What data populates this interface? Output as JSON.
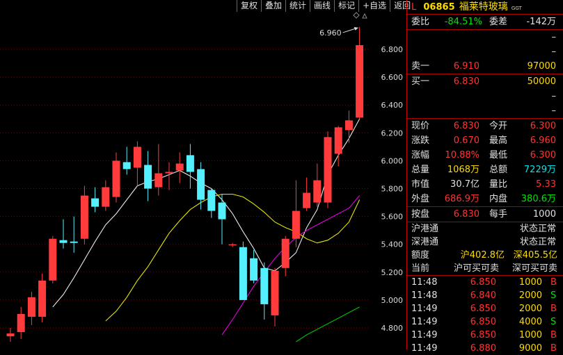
{
  "toolbar": [
    "复权",
    "叠加",
    "统计",
    "画线",
    "标记",
    "+自选",
    "返回"
  ],
  "chart_data": {
    "type": "candlestick",
    "y_ticks": [
      "6.800",
      "6.600",
      "6.400",
      "6.200",
      "6.000",
      "5.800",
      "5.600",
      "5.400",
      "5.200",
      "5.000",
      "4.800"
    ],
    "ylim": [
      4.72,
      7.02
    ],
    "high_annotation": "6.960",
    "candles": [
      {
        "o": 4.74,
        "h": 4.8,
        "l": 4.7,
        "c": 4.76
      },
      {
        "o": 4.77,
        "h": 4.95,
        "l": 4.72,
        "c": 4.9
      },
      {
        "o": 4.88,
        "h": 5.06,
        "l": 4.82,
        "c": 5.02
      },
      {
        "o": 4.88,
        "h": 5.19,
        "l": 4.84,
        "c": 5.14
      },
      {
        "o": 5.14,
        "h": 5.46,
        "l": 5.12,
        "c": 5.44
      },
      {
        "o": 5.43,
        "h": 5.58,
        "l": 5.37,
        "c": 5.41
      },
      {
        "o": 5.42,
        "h": 5.6,
        "l": 5.34,
        "c": 5.41
      },
      {
        "o": 5.44,
        "h": 5.82,
        "l": 5.4,
        "c": 5.75
      },
      {
        "o": 5.73,
        "h": 5.81,
        "l": 5.63,
        "c": 5.67
      },
      {
        "o": 5.67,
        "h": 5.86,
        "l": 5.64,
        "c": 5.81
      },
      {
        "o": 5.74,
        "h": 6.06,
        "l": 5.7,
        "c": 6.0
      },
      {
        "o": 5.99,
        "h": 6.1,
        "l": 5.9,
        "c": 5.94
      },
      {
        "o": 5.95,
        "h": 6.14,
        "l": 5.82,
        "c": 6.1
      },
      {
        "o": 5.97,
        "h": 6.07,
        "l": 5.71,
        "c": 5.8
      },
      {
        "o": 5.81,
        "h": 6.12,
        "l": 5.75,
        "c": 5.91
      },
      {
        "o": 5.91,
        "h": 5.99,
        "l": 5.79,
        "c": 5.92
      },
      {
        "o": 5.93,
        "h": 6.06,
        "l": 5.84,
        "c": 5.98
      },
      {
        "o": 6.04,
        "h": 6.12,
        "l": 5.8,
        "c": 5.92
      },
      {
        "o": 5.94,
        "h": 5.99,
        "l": 5.65,
        "c": 5.72
      },
      {
        "o": 5.79,
        "h": 5.8,
        "l": 5.59,
        "c": 5.64
      },
      {
        "o": 5.7,
        "h": 5.76,
        "l": 5.4,
        "c": 5.58
      },
      {
        "o": 5.4,
        "h": 5.41,
        "l": 5.38,
        "c": 5.4
      },
      {
        "o": 5.38,
        "h": 5.42,
        "l": 5.0,
        "c": 5.0
      },
      {
        "o": 5.3,
        "h": 5.36,
        "l": 5.12,
        "c": 5.14
      },
      {
        "o": 5.23,
        "h": 5.27,
        "l": 4.86,
        "c": 4.97
      },
      {
        "o": 4.89,
        "h": 5.23,
        "l": 4.81,
        "c": 5.21
      },
      {
        "o": 5.23,
        "h": 5.46,
        "l": 5.17,
        "c": 5.44
      },
      {
        "o": 5.44,
        "h": 5.86,
        "l": 5.38,
        "c": 5.64
      },
      {
        "o": 5.66,
        "h": 5.88,
        "l": 5.64,
        "c": 5.77
      },
      {
        "o": 5.7,
        "h": 5.98,
        "l": 5.67,
        "c": 5.86
      },
      {
        "o": 5.7,
        "h": 6.21,
        "l": 5.66,
        "c": 6.17
      },
      {
        "o": 6.05,
        "h": 6.25,
        "l": 5.96,
        "c": 6.24
      },
      {
        "o": 6.22,
        "h": 6.36,
        "l": 6.13,
        "c": 6.29
      },
      {
        "o": 6.31,
        "h": 6.96,
        "l": 6.3,
        "c": 6.83
      }
    ],
    "ma_lines": [
      {
        "color": "#e8e8e8",
        "values": [
          null,
          null,
          null,
          null,
          4.95,
          5.04,
          5.16,
          5.29,
          5.42,
          5.54,
          5.62,
          5.72,
          5.82,
          5.85,
          5.87,
          5.9,
          5.93,
          5.89,
          5.84,
          5.8,
          5.72,
          5.62,
          5.49,
          5.37,
          5.23,
          5.21,
          5.27,
          5.34,
          5.52,
          5.65,
          5.9,
          6.04,
          6.16,
          6.3
        ]
      },
      {
        "color": "#e6e600",
        "values": [
          null,
          null,
          null,
          null,
          null,
          null,
          null,
          null,
          null,
          4.85,
          4.92,
          5.02,
          5.14,
          5.24,
          5.36,
          5.48,
          5.57,
          5.65,
          5.7,
          5.74,
          5.76,
          5.76,
          5.74,
          5.69,
          5.63,
          5.56,
          5.52,
          5.49,
          5.44,
          5.41,
          5.43,
          5.48,
          5.56,
          5.72
        ]
      },
      {
        "color": "#e000e0",
        "values": [
          null,
          null,
          null,
          null,
          null,
          null,
          null,
          null,
          null,
          null,
          null,
          null,
          null,
          null,
          null,
          null,
          null,
          null,
          null,
          4.62,
          4.75,
          4.86,
          4.98,
          5.1,
          5.2,
          5.3,
          5.38,
          5.45,
          5.5,
          5.54,
          5.58,
          5.62,
          5.66,
          5.75
        ]
      },
      {
        "color": "#00c000",
        "values": [
          null,
          null,
          null,
          null,
          null,
          null,
          null,
          null,
          null,
          null,
          null,
          null,
          null,
          null,
          null,
          null,
          null,
          null,
          null,
          null,
          null,
          null,
          null,
          4.5,
          4.55,
          4.6,
          4.65,
          4.7,
          4.75,
          4.79,
          4.83,
          4.87,
          4.91,
          4.95
        ]
      }
    ]
  },
  "quote": {
    "tag": "L",
    "code": "06865",
    "name": "福莱特玻璃",
    "suffix": "GGT",
    "weibi_label": "委比",
    "weibi": "-84.51%",
    "weicha_label": "委差",
    "weicha": "-142万",
    "sell_label": "卖一",
    "sell_price": "6.910",
    "sell_vol": "97000",
    "buy_label": "买一",
    "buy_price": "6.830",
    "buy_vol": "50000",
    "dash": "–",
    "stats": [
      {
        "l1": "现价",
        "v1": "6.830",
        "c1": "red",
        "l2": "今开",
        "v2": "6.300",
        "c2": "red"
      },
      {
        "l1": "涨跌",
        "v1": "0.670",
        "c1": "red",
        "l2": "最高",
        "v2": "6.960",
        "c2": "red"
      },
      {
        "l1": "涨幅",
        "v1": "10.88%",
        "c1": "red",
        "l2": "最低",
        "v2": "6.300",
        "c2": "red"
      },
      {
        "l1": "总量",
        "v1": "1068万",
        "c1": "yellow",
        "l2": "总额",
        "v2": "7229万",
        "c2": "cyan"
      },
      {
        "l1": "市值",
        "v1": "30.7亿",
        "c1": "white",
        "l2": "量比",
        "v2": "5.33",
        "c2": "red"
      },
      {
        "l1": "外盘",
        "v1": "686.9万",
        "c1": "red",
        "l2": "内盘",
        "v2": "380.6万",
        "c2": "green"
      }
    ],
    "anpan_label": "按盘",
    "anpan": "6.830",
    "meishou_label": "每手",
    "meishou": "1000",
    "hgt_label": "沪港通",
    "hgt_status": "状态正常",
    "sgt_label": "深港通",
    "sgt_status": "状态正常",
    "quota_label": "额度",
    "quota_sh": "沪402.8亿",
    "quota_sz": "深405.5亿",
    "now_label": "当前",
    "now_sh": "沪可买可卖",
    "now_sz": "深可买可卖"
  },
  "ticks": [
    {
      "time": "11:48",
      "price": "6.850",
      "vol": "1000",
      "side": "B"
    },
    {
      "time": "11:48",
      "price": "6.840",
      "vol": "2000",
      "side": "S"
    },
    {
      "time": "11:49",
      "price": "6.850",
      "vol": "2000",
      "side": "B"
    },
    {
      "time": "11:49",
      "price": "6.850",
      "vol": "4000",
      "side": "S"
    },
    {
      "time": "11:49",
      "price": "6.850",
      "vol": "1000",
      "side": "B"
    },
    {
      "time": "11:49",
      "price": "6.880",
      "vol": "9000",
      "side": "B"
    }
  ]
}
